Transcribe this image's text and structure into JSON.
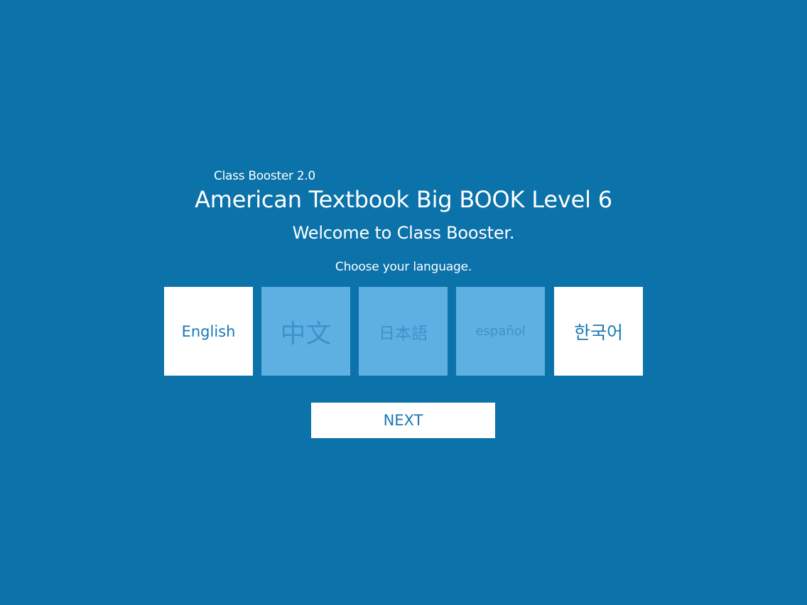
{
  "header": {
    "app_name": "Class Booster 2.0",
    "title": "American Textbook Big BOOK Level 6",
    "welcome": "Welcome to Class Booster.",
    "prompt": "Choose your language."
  },
  "languages": [
    {
      "label": "English",
      "state": "selected"
    },
    {
      "label": "中文",
      "state": "unselected"
    },
    {
      "label": "日本語",
      "state": "unselected"
    },
    {
      "label": "español",
      "state": "unselected"
    },
    {
      "label": "한국어",
      "state": "selected"
    }
  ],
  "actions": {
    "next_label": "NEXT"
  },
  "colors": {
    "background": "#0c72aa",
    "tile_selected": "#ffffff",
    "tile_unselected": "#5fb0e2",
    "accent_text": "#1a78b3"
  }
}
